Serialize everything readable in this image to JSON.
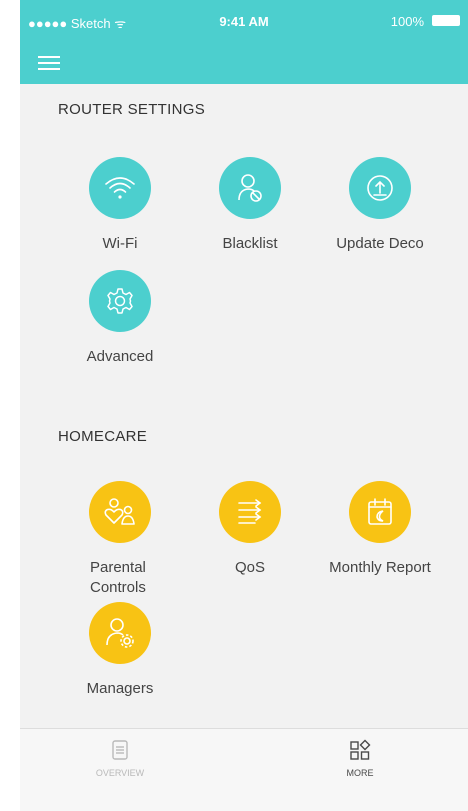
{
  "status_bar": {
    "carrier": "●●●●● Sketch ᯤ",
    "time": "9:41 AM",
    "battery": "100%"
  },
  "colors": {
    "teal": "#4ccfce",
    "yellow": "#f8c314"
  },
  "router_settings": {
    "title": "ROUTER SETTINGS",
    "items": [
      {
        "label": "Wi-Fi",
        "icon": "wifi-icon"
      },
      {
        "label": "Blacklist",
        "icon": "blacklist-user-icon"
      },
      {
        "label": "Update Deco",
        "icon": "update-upload-icon"
      },
      {
        "label": "Advanced",
        "icon": "gear-icon"
      }
    ]
  },
  "homecare": {
    "title": "HOMECARE",
    "items": [
      {
        "label": "Parental Controls",
        "icon": "parental-controls-icon"
      },
      {
        "label": "QoS",
        "icon": "qos-arrows-icon"
      },
      {
        "label": "Monthly Report",
        "icon": "calendar-report-icon"
      },
      {
        "label": "Managers",
        "icon": "manager-user-gear-icon"
      }
    ]
  },
  "tabs": [
    {
      "label": "OVERVIEW",
      "icon": "overview-list-icon",
      "active": false
    },
    {
      "label": "MORE",
      "icon": "more-grid-icon",
      "active": true
    }
  ]
}
